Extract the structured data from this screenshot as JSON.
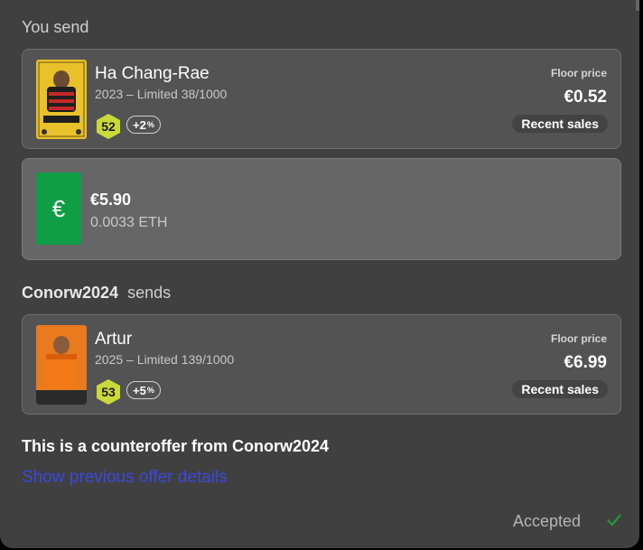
{
  "you_send": {
    "label": "You send",
    "card": {
      "player_name": "Ha Chang-Rae",
      "meta": "2023 – Limited 38/1000",
      "rating": "52",
      "bonus": "+2",
      "bonus_unit": "%",
      "floor_label": "Floor price",
      "floor_price": "€0.52",
      "recent_sales": "Recent sales",
      "thumb_name": "HA\nCHANG RAE"
    },
    "money": {
      "symbol": "€",
      "eur": "€5.90",
      "eth": "0.0033 ETH"
    }
  },
  "they_send": {
    "user": "Conorw2024",
    "label": "sends",
    "card": {
      "player_name": "Artur",
      "meta": "2025 – Limited 139/1000",
      "rating": "53",
      "bonus": "+5",
      "bonus_unit": "%",
      "floor_label": "Floor price",
      "floor_price": "€6.99",
      "recent_sales": "Recent sales",
      "thumb_name": "ARTUR"
    }
  },
  "counteroffer_text": "This is a counteroffer from Conorw2024",
  "previous_link": "Show previous offer details",
  "status": "Accepted",
  "colors": {
    "panel": "#404040",
    "rating": "#c9d93a",
    "euro_box": "#0f9d45",
    "link": "#3b48e0",
    "accepted_check": "#1d9a3a"
  }
}
